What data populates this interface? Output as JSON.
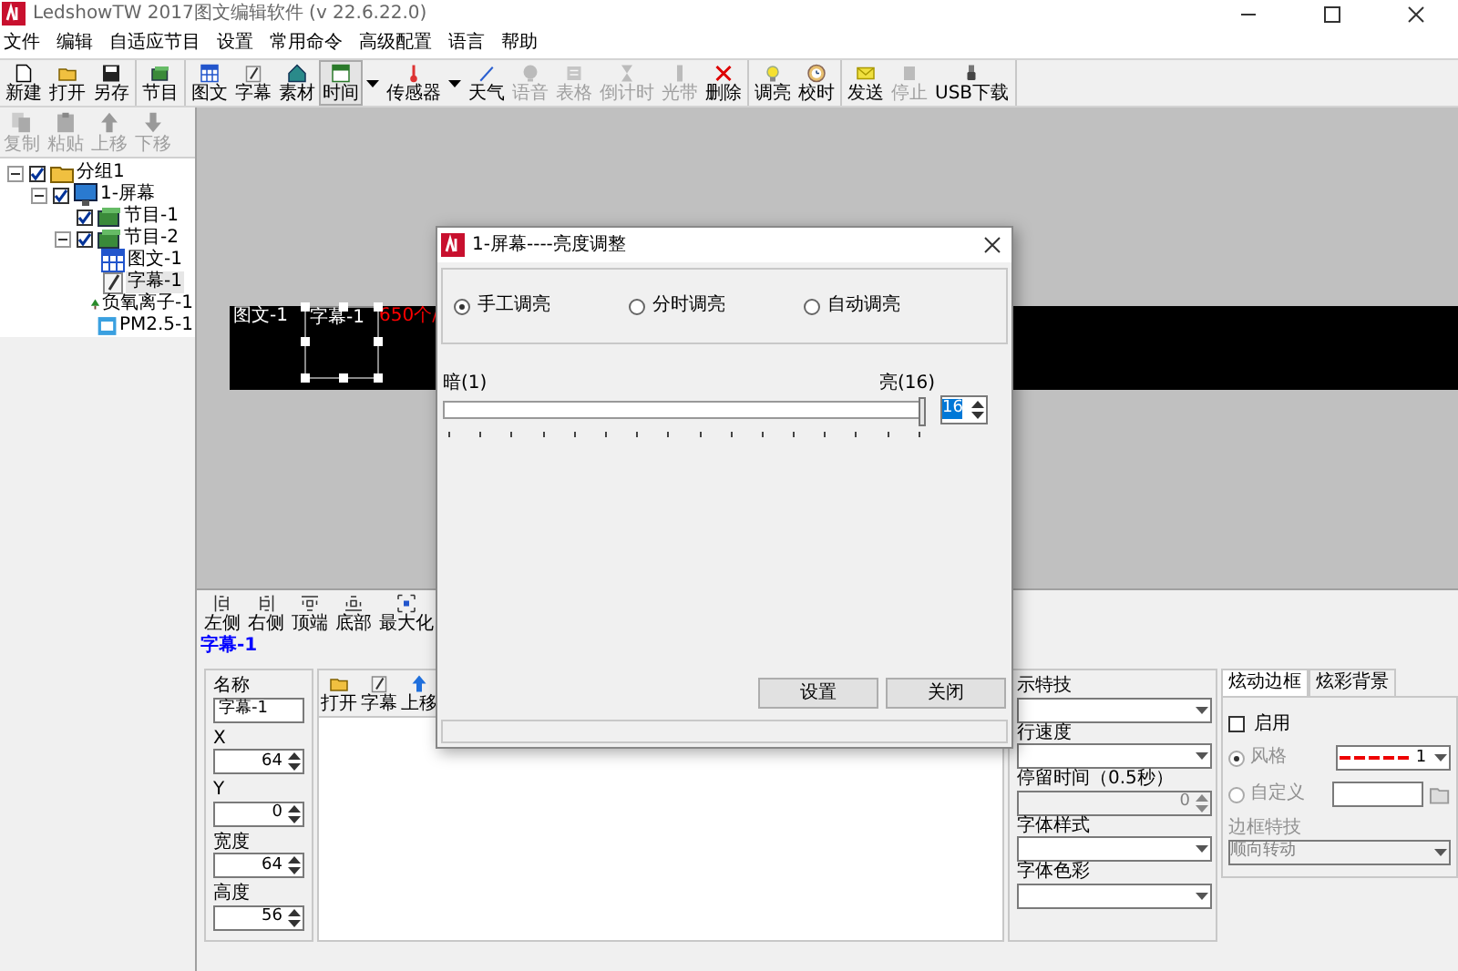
{
  "window": {
    "title": "LedshowTW 2017图文编辑软件 (v 22.6.22.0)"
  },
  "menu": [
    "文件",
    "编辑",
    "自适应节目",
    "设置",
    "常用命令",
    "高级配置",
    "语言",
    "帮助"
  ],
  "toolbar_groups": [
    {
      "items": [
        {
          "label": "新建",
          "disabled": false,
          "pressed": false,
          "dropdown": false
        },
        {
          "label": "打开",
          "disabled": false,
          "pressed": false,
          "dropdown": false
        },
        {
          "label": "另存",
          "disabled": false,
          "pressed": false,
          "dropdown": false
        }
      ]
    },
    {
      "items": [
        {
          "label": "节目",
          "disabled": false,
          "pressed": false,
          "dropdown": false
        }
      ]
    },
    {
      "items": [
        {
          "label": "图文",
          "disabled": false,
          "pressed": false,
          "dropdown": false
        },
        {
          "label": "字幕",
          "disabled": false,
          "pressed": false,
          "dropdown": false
        },
        {
          "label": "素材",
          "disabled": false,
          "pressed": false,
          "dropdown": false
        },
        {
          "label": "时间",
          "disabled": false,
          "pressed": true,
          "dropdown": true
        },
        {
          "label": "传感器",
          "disabled": false,
          "pressed": false,
          "dropdown": true
        },
        {
          "label": "天气",
          "disabled": false,
          "pressed": false,
          "dropdown": false
        },
        {
          "label": "语音",
          "disabled": true,
          "pressed": false,
          "dropdown": false
        },
        {
          "label": "表格",
          "disabled": true,
          "pressed": false,
          "dropdown": false
        },
        {
          "label": "倒计时",
          "disabled": true,
          "pressed": false,
          "dropdown": false
        },
        {
          "label": "光带",
          "disabled": true,
          "pressed": false,
          "dropdown": false
        },
        {
          "label": "删除",
          "disabled": false,
          "pressed": false,
          "dropdown": false
        }
      ]
    },
    {
      "items": [
        {
          "label": "调亮",
          "disabled": false,
          "pressed": false,
          "dropdown": false
        },
        {
          "label": "校时",
          "disabled": false,
          "pressed": false,
          "dropdown": false
        }
      ]
    },
    {
      "items": [
        {
          "label": "发送",
          "disabled": false,
          "pressed": false,
          "dropdown": false
        },
        {
          "label": "停止",
          "disabled": true,
          "pressed": false,
          "dropdown": false
        },
        {
          "label": "USB下载",
          "disabled": false,
          "pressed": false,
          "dropdown": false
        }
      ]
    }
  ],
  "edit_toolbar": [
    {
      "label": "复制",
      "disabled": true
    },
    {
      "label": "粘贴",
      "disabled": true
    },
    {
      "label": "上移",
      "disabled": true
    },
    {
      "label": "下移",
      "disabled": true
    }
  ],
  "tree": [
    {
      "label": "分组1",
      "kind": "group",
      "checked": true,
      "expanded": true,
      "selected": false,
      "children": [
        {
          "label": "1-屏幕",
          "kind": "screen",
          "checked": true,
          "expanded": true,
          "selected": false,
          "children": [
            {
              "label": "节目-1",
              "kind": "program",
              "checked": true,
              "selected": false
            },
            {
              "label": "节目-2",
              "kind": "program",
              "checked": true,
              "expanded": true,
              "selected": false,
              "children": [
                {
                  "label": "图文-1",
                  "kind": "graphic",
                  "selected": false
                },
                {
                  "label": "字幕-1",
                  "kind": "caption",
                  "selected": true
                },
                {
                  "label": "负氧离子-1",
                  "kind": "anion",
                  "selected": false
                },
                {
                  "label": "PM2.5-1",
                  "kind": "pm",
                  "selected": false
                }
              ]
            }
          ]
        }
      ]
    }
  ],
  "canvas": {
    "areas": [
      {
        "label": "图文-1",
        "selected": false
      },
      {
        "label": "字幕-1",
        "selected": true
      }
    ],
    "ticker": "650个/"
  },
  "dialog": {
    "title": "1-屏幕----亮度调整",
    "modes": [
      {
        "label": "手工调亮",
        "selected": true
      },
      {
        "label": "分时调亮",
        "selected": false
      },
      {
        "label": "自动调亮",
        "selected": false
      }
    ],
    "slider": {
      "min_label": "暗(1)",
      "max_label": "亮(16)",
      "level": 1,
      "value": "16"
    },
    "buttons": [
      "设置",
      "关闭"
    ]
  },
  "align_toolbar": [
    "左侧",
    "右侧",
    "顶端",
    "底部",
    "最大化"
  ],
  "selected_object": "字幕-1",
  "properties": [
    {
      "label": "名称",
      "value": "字幕-1",
      "kind": "text"
    },
    {
      "label": "X",
      "value": "64",
      "kind": "spinner"
    },
    {
      "label": "Y",
      "value": "0",
      "kind": "spinner"
    },
    {
      "label": "宽度",
      "value": "64",
      "kind": "spinner"
    },
    {
      "label": "高度",
      "value": "56",
      "kind": "spinner"
    }
  ],
  "content_toolbar": [
    "打开",
    "字幕",
    "上移"
  ],
  "effects": [
    {
      "label": "示特技",
      "kind": "select",
      "disabled": false
    },
    {
      "label": "行速度",
      "kind": "select",
      "disabled": false
    },
    {
      "label": "停留时间（0.5秒）",
      "kind": "spinner",
      "value": "0",
      "disabled": true
    },
    {
      "label": "字体样式",
      "kind": "select",
      "disabled": false
    },
    {
      "label": "字体色彩",
      "kind": "select",
      "disabled": false
    }
  ],
  "border_panel": {
    "tabs": [
      {
        "label": "炫动边框",
        "selected": true
      },
      {
        "label": "炫彩背景",
        "selected": false
      }
    ],
    "enable": {
      "label": "启用",
      "checked": false
    },
    "options": [
      {
        "label": "风格",
        "kind": "style",
        "value": "1",
        "selected": true,
        "disabled": true
      },
      {
        "label": "自定义",
        "kind": "custom",
        "selected": false,
        "disabled": true
      }
    ],
    "effect_label": "边框特技",
    "effect_value": "顺向转动"
  }
}
